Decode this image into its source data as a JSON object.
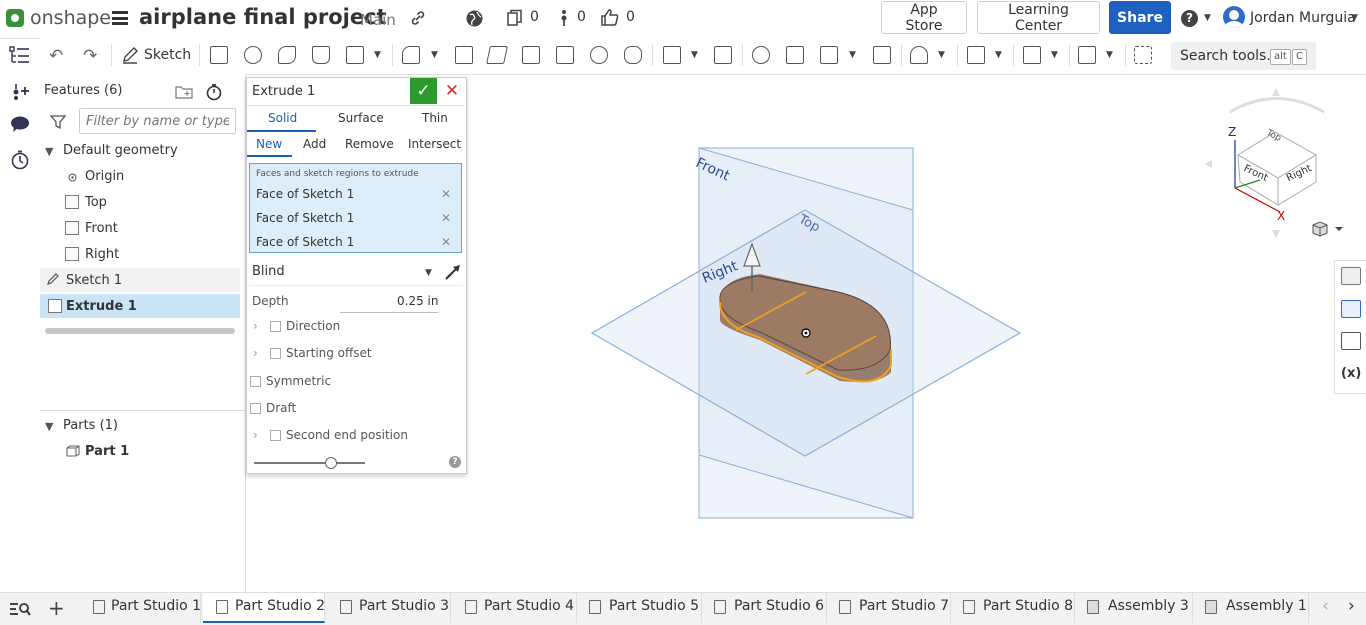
{
  "app": {
    "brand": "onshape",
    "document_title": "airplane final project",
    "branch": "Main"
  },
  "header": {
    "doc_count": "0",
    "version_count": "0",
    "like_count": "0",
    "app_store": "App Store",
    "learning_center": "Learning Center",
    "share": "Share",
    "user": "Jordan Murguia"
  },
  "toolbar": {
    "sketch": "Sketch",
    "search_tools": "Search tools...",
    "shortcut_key1": "alt",
    "shortcut_key2": "C"
  },
  "feature_panel": {
    "title": "Features (6)",
    "filter_placeholder": "Filter by name or type",
    "default_geometry": "Default geometry",
    "origin": "Origin",
    "top": "Top",
    "front": "Front",
    "right": "Right",
    "sketch1": "Sketch 1",
    "extrude1": "Extrude 1",
    "parts_header": "Parts (1)",
    "part1": "Part 1"
  },
  "dialog": {
    "title": "Extrude 1",
    "tabs": [
      "Solid",
      "Surface",
      "Thin"
    ],
    "ops": [
      "New",
      "Add",
      "Remove",
      "Intersect"
    ],
    "selection_label": "Faces and sketch regions to extrude",
    "selections": [
      "Face of Sketch 1",
      "Face of Sketch 1",
      "Face of Sketch 1"
    ],
    "end_type": "Blind",
    "depth_label": "Depth",
    "depth_value": "0.25 in",
    "direction": "Direction",
    "starting_offset": "Starting offset",
    "symmetric": "Symmetric",
    "draft": "Draft",
    "second_end": "Second end position"
  },
  "viewport": {
    "plane_front": "Front",
    "plane_top": "Top",
    "plane_right": "Right",
    "cube_top": "Top",
    "cube_front": "Front",
    "cube_right": "Right",
    "axis_x": "X",
    "axis_z": "Z"
  },
  "bottom_tabs": [
    "Part Studio 1",
    "Part Studio 2",
    "Part Studio 3",
    "Part Studio 4",
    "Part Studio 5",
    "Part Studio 6",
    "Part Studio 7",
    "Part Studio 8",
    "Assembly 3",
    "Assembly 1"
  ],
  "colors": {
    "accent": "#1a5fb4",
    "ok": "#2e9a2e",
    "part": "#8b6a55",
    "edge": "#f0a020"
  }
}
